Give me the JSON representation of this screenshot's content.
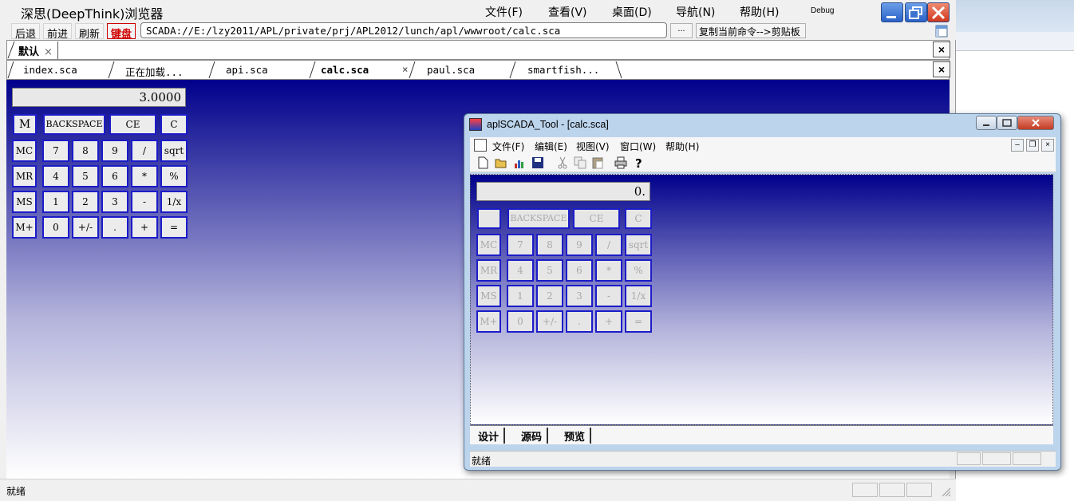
{
  "browser": {
    "title": "深思(DeepThink)浏览器",
    "menu": [
      "文件(F)",
      "查看(V)",
      "桌面(D)",
      "导航(N)",
      "帮助(H)"
    ],
    "debug_label": "Debug",
    "nav": {
      "back": "后退",
      "forward": "前进",
      "refresh": "刷新",
      "keyboard": "键盘",
      "url": "SCADA://E:/lzy2011/APL/private/prj/APL2012/lunch/apl/wwwroot/calc.sca",
      "more": "...",
      "copy_command": "复制当前命令-->剪贴板"
    },
    "top_tab": {
      "label": "默认",
      "close": "×"
    },
    "doc_tabs": [
      "index.sca",
      "正在加载...",
      "api.sca",
      "calc.sca",
      "paul.sca",
      "smartfish..."
    ],
    "active_tab_close": "×",
    "close_label": "×",
    "status": "就绪"
  },
  "calculator": {
    "display": "3.0000",
    "memory_indicator": "M",
    "top_row": [
      "BACKSPACE",
      "CE",
      "C"
    ],
    "rows": [
      [
        "MC",
        "7",
        "8",
        "9",
        "/",
        "sqrt"
      ],
      [
        "MR",
        "4",
        "5",
        "6",
        "*",
        "%"
      ],
      [
        "MS",
        "1",
        "2",
        "3",
        "-",
        "1/x"
      ],
      [
        "M+",
        "0",
        "+/-",
        ".",
        "+",
        "="
      ]
    ]
  },
  "tool": {
    "title": "aplSCADA_Tool - [calc.sca]",
    "menu": [
      "文件(F)",
      "编辑(E)",
      "视图(V)",
      "窗口(W)",
      "帮助(H)"
    ],
    "toolbar_icons": [
      "new-icon",
      "open-icon",
      "chart-icon",
      "save-icon",
      "cut-icon",
      "copy-icon",
      "paste-icon",
      "print-icon",
      "help-icon"
    ],
    "calculator": {
      "display": "0.",
      "memory_indicator": ""
    },
    "tabs": [
      "设计",
      "源码",
      "预览"
    ],
    "status": "就绪"
  },
  "colors": {
    "calc_button_border": "#1c1cc8",
    "content_gradient_top": "#00008c",
    "keyboard_accent": "#d00000"
  }
}
